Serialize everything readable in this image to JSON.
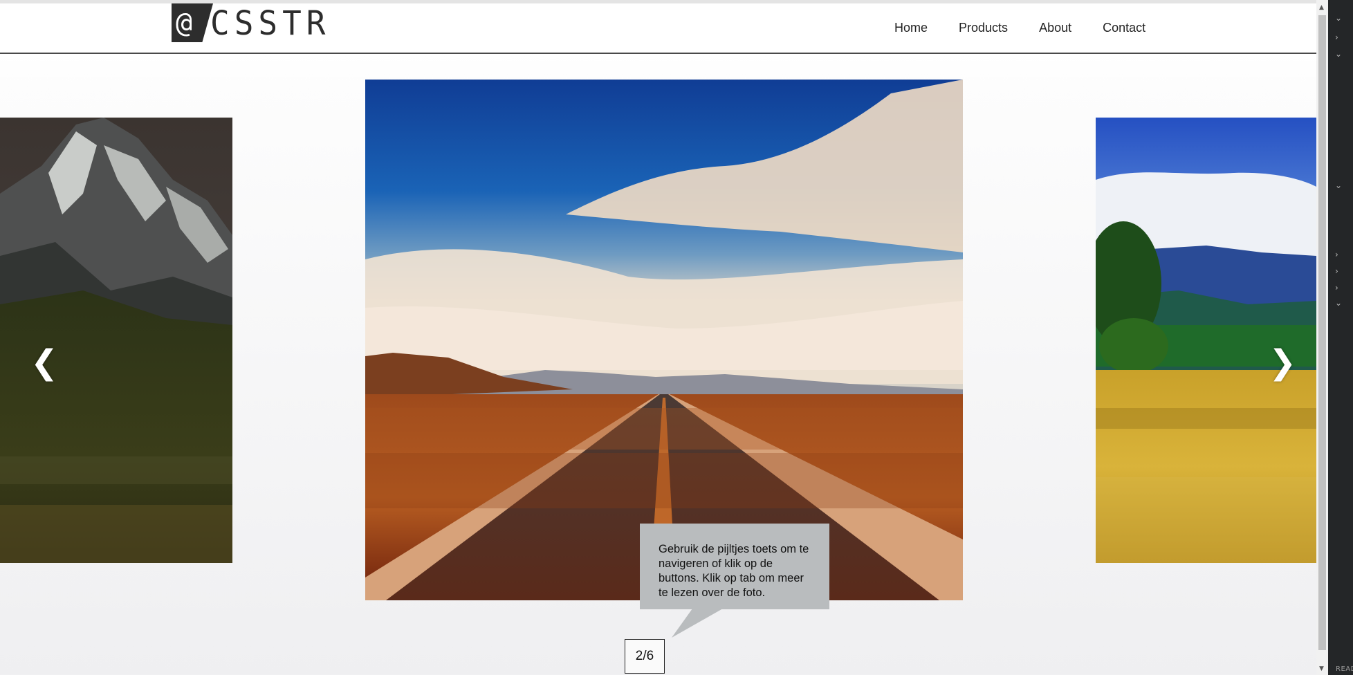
{
  "header": {
    "logo_mark": "@",
    "logo_text": "CSSTR",
    "nav": [
      "Home",
      "Products",
      "About",
      "Contact"
    ]
  },
  "carousel": {
    "prev_arrow": "❮",
    "next_arrow": "❯",
    "counter": "2/6",
    "hint": "Gebruik de pijltjes toets om te navigeren of klik op de buttons. Klik op tab om meer te lezen over de foto."
  },
  "side_panel": {
    "status_text": "READ"
  },
  "icons": {
    "prev": "chevron-left-icon",
    "next": "chevron-right-icon",
    "scroll_up": "triangle-up-icon",
    "scroll_down": "triangle-down-icon"
  },
  "colors": {
    "header_border": "#4a4a4a",
    "tooltip_bg": "#b9bcbe",
    "side_panel_bg": "#242628"
  }
}
